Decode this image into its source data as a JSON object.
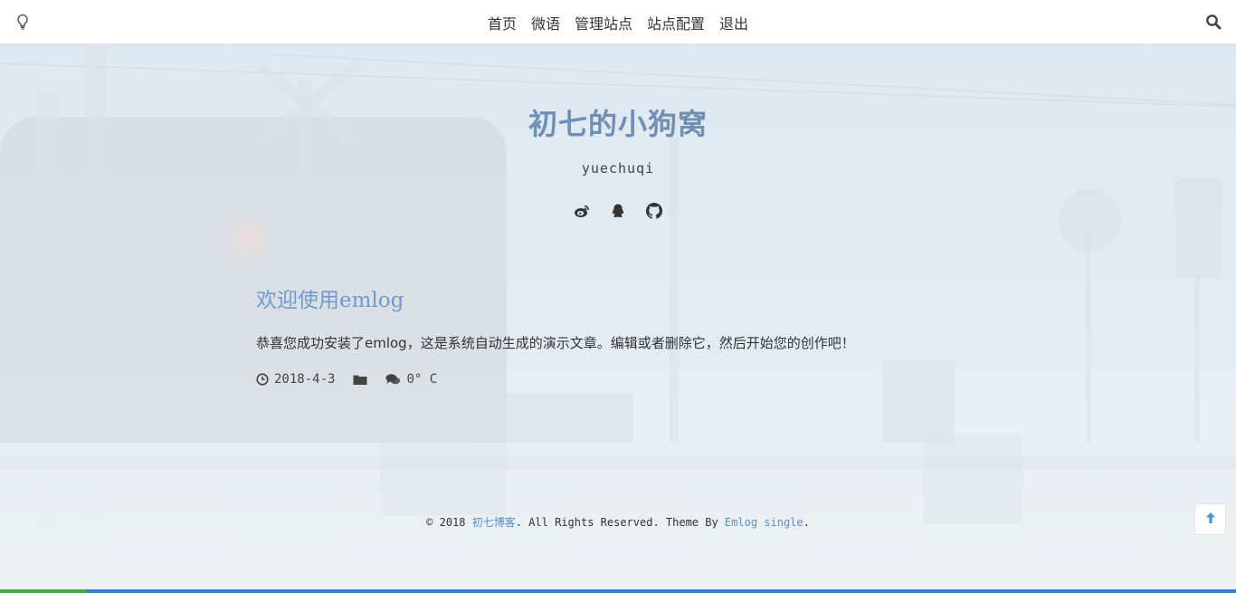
{
  "nav": {
    "left_icon": "lightbulb-icon",
    "items": [
      {
        "label": "首页"
      },
      {
        "label": "微语"
      },
      {
        "label": "管理站点"
      },
      {
        "label": "站点配置"
      },
      {
        "label": "退出"
      }
    ],
    "search_icon": "search-icon"
  },
  "header": {
    "title": "初七的小狗窝",
    "subtitle": "yuechuqi",
    "social": [
      "weibo-icon",
      "qq-icon",
      "github-icon"
    ]
  },
  "post": {
    "title": "欢迎使用emlog",
    "excerpt": "恭喜您成功安装了emlog，这是系统自动生成的演示文章。编辑或者删除它，然后开始您的创作吧！",
    "date": "2018-4-3",
    "comments": "0",
    "temperature_suffix": "° C"
  },
  "footer": {
    "prefix": "© 2018 ",
    "blog_name": "初七博客",
    "middle": ". All Rights Reserved. Theme By ",
    "theme_name": "Emlog single",
    "suffix": "."
  },
  "colors": {
    "accent": "#6f9ad0",
    "title": "#6f8fb5",
    "link": "#5b8fc9"
  }
}
